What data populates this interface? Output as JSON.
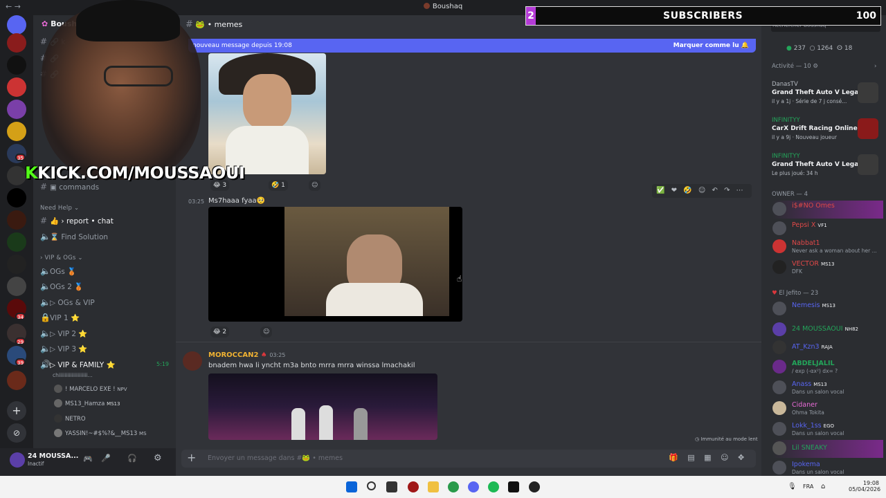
{
  "window": {
    "title": "Boushaq"
  },
  "server": {
    "name": "Boushaq",
    "current_channel": "memes"
  },
  "channel_header": {
    "icon": "frog-emoji",
    "name": "memes"
  },
  "new_messages_bar": {
    "text": "nouveau message depuis 19:08",
    "mark_read": "Marquer comme lu"
  },
  "sidebar": {
    "commands_label": "commands",
    "need_help_category": "Need Help",
    "report_chat": "report • chat",
    "find_solution": "Find Solution",
    "vip_category": "VIP & OGs",
    "voice_channels": [
      "OGs 🥉",
      "OGs 2 🥉",
      "▷ OGs & VIP",
      "VIP 1 ⭐",
      "▷ VIP 2 ⭐",
      "▷ VIP 3 ⭐",
      "▷ VIP & FAMILY ⭐"
    ],
    "vip_family_time": "5:19",
    "voice_status_text": "chiiiiiiiiiiiiiiiiiiii...",
    "voice_users": [
      "! MARCELO EXE !",
      "MS13_Hamza",
      "NETRO",
      "YASSIN!~#$%?&__MS13"
    ],
    "voice_user_tags": [
      "NPV",
      "MS13",
      "",
      "MS"
    ]
  },
  "user_panel": {
    "name": "24 MOUSSA...",
    "status": "Inactif"
  },
  "messages": [
    {
      "time": "03:25",
      "text": "Ms7haaa fyaa🥺",
      "reactions": [
        "😂 3",
        "🤣 1"
      ]
    },
    {
      "reactions": [
        "😂 2"
      ]
    },
    {
      "author": "MOROCCAN2",
      "time": "03:25",
      "text": "bnadem hwa li yncht m3a bnto mrra mrra winssa lmachakil"
    }
  ],
  "composer": {
    "placeholder": "Envoyer un message dans #🐸 • memes"
  },
  "slowmode": "Immunité au mode lent",
  "members_panel": {
    "online": "237",
    "total": "1264",
    "age": "18",
    "search_placeholder": "Rechercher Boushaq",
    "activity_header": "Activité — 10",
    "activities": [
      {
        "user": "DanasTV",
        "game": "Grand Theft Auto V Legacy",
        "detail": "il y a 1j · Série de 7 j consé..."
      },
      {
        "user": "INFINITYY",
        "game": "CarX Drift Racing Online",
        "detail": "il y a 9j · Nouveau joueur"
      },
      {
        "user": "INFINITYY",
        "game": "Grand Theft Auto V Legacy",
        "detail": "Le plus joué: 34 h"
      }
    ],
    "owner_header": "OWNER — 4",
    "owners": [
      {
        "name": "i$#NO Omes",
        "tag": "",
        "status": ""
      },
      {
        "name": "Pepsi X",
        "tag": "VF1",
        "status": ""
      },
      {
        "name": "Nabbat1",
        "tag": "",
        "status": "Never ask a woman about her ..."
      },
      {
        "name": "VECTOR",
        "tag": "MS13",
        "status": "DFK"
      }
    ],
    "jefito_header": "El Jefito — 23",
    "jefito": [
      {
        "name": "Nemesis",
        "tag": "MS13",
        "status": ""
      },
      {
        "name": "24 MOUSSAOUI",
        "tag": "NH82",
        "status": ""
      },
      {
        "name": "AT_Kzn3",
        "tag": "RAJA",
        "status": ""
      },
      {
        "name": "ABDELJALIL",
        "tag": "",
        "status": "/ exp (-αx²) dx= ?"
      },
      {
        "name": "Anass",
        "tag": "MS13",
        "status": "Dans un salon vocal"
      },
      {
        "name": "Cidaner",
        "tag": "",
        "status": "Ohma Tokita"
      },
      {
        "name": "Lokk_1ss",
        "tag": "EGO",
        "status": "Dans un salon vocal"
      },
      {
        "name": "Lil SNEAKY",
        "tag": "",
        "status": ""
      },
      {
        "name": "Ipokema",
        "tag": "",
        "status": "Dans un salon vocal"
      }
    ]
  },
  "stream_overlay": {
    "subs_current": "2",
    "subs_label": "SUBSCRIBERS",
    "subs_goal": "100",
    "kick_prefix": "K",
    "kick_url": "KICK.COM/MOUSSAOUI"
  },
  "taskbar": {
    "language": "FRA",
    "time": "19:08",
    "date": "05/04/2026"
  },
  "colors": {
    "blurple": "#5865f2",
    "bg_main": "#313338",
    "bg_sidebar": "#2b2d31",
    "kick_green": "#53fc18",
    "sub_purple": "#b43bd6"
  }
}
